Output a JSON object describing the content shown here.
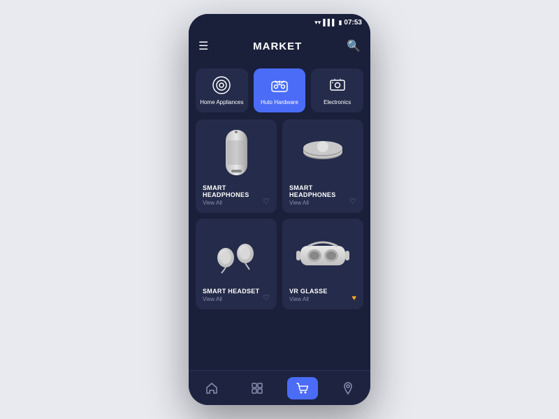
{
  "status": {
    "time": "07:53"
  },
  "header": {
    "title": "MARKET"
  },
  "categories": [
    {
      "id": "home-appliances",
      "label": "Home Appliances",
      "active": false
    },
    {
      "id": "auto-hardware",
      "label": "Huto Hardware",
      "active": true
    },
    {
      "id": "electronics",
      "label": "Electronics",
      "active": false
    }
  ],
  "products": [
    {
      "id": "smart-headphones-1",
      "name": "SMART HEADPHONES",
      "viewAll": "View All",
      "heartActive": false
    },
    {
      "id": "smart-headphones-2",
      "name": "SMART HEADPHONES",
      "viewAll": "View All",
      "heartActive": false
    },
    {
      "id": "smart-headset",
      "name": "SMART HEADSET",
      "viewAll": "View All",
      "heartActive": false
    },
    {
      "id": "vr-glasse",
      "name": "VR GLASSE",
      "viewAll": "View All",
      "heartActive": true
    }
  ],
  "nav": {
    "items": [
      {
        "id": "home",
        "active": false
      },
      {
        "id": "grid",
        "active": false
      },
      {
        "id": "cart",
        "active": true
      },
      {
        "id": "location",
        "active": false
      }
    ]
  },
  "colors": {
    "active": "#4a6cf7",
    "card": "#252b4a",
    "bg": "#1a1f3a",
    "heartActive": "#f5a623"
  }
}
